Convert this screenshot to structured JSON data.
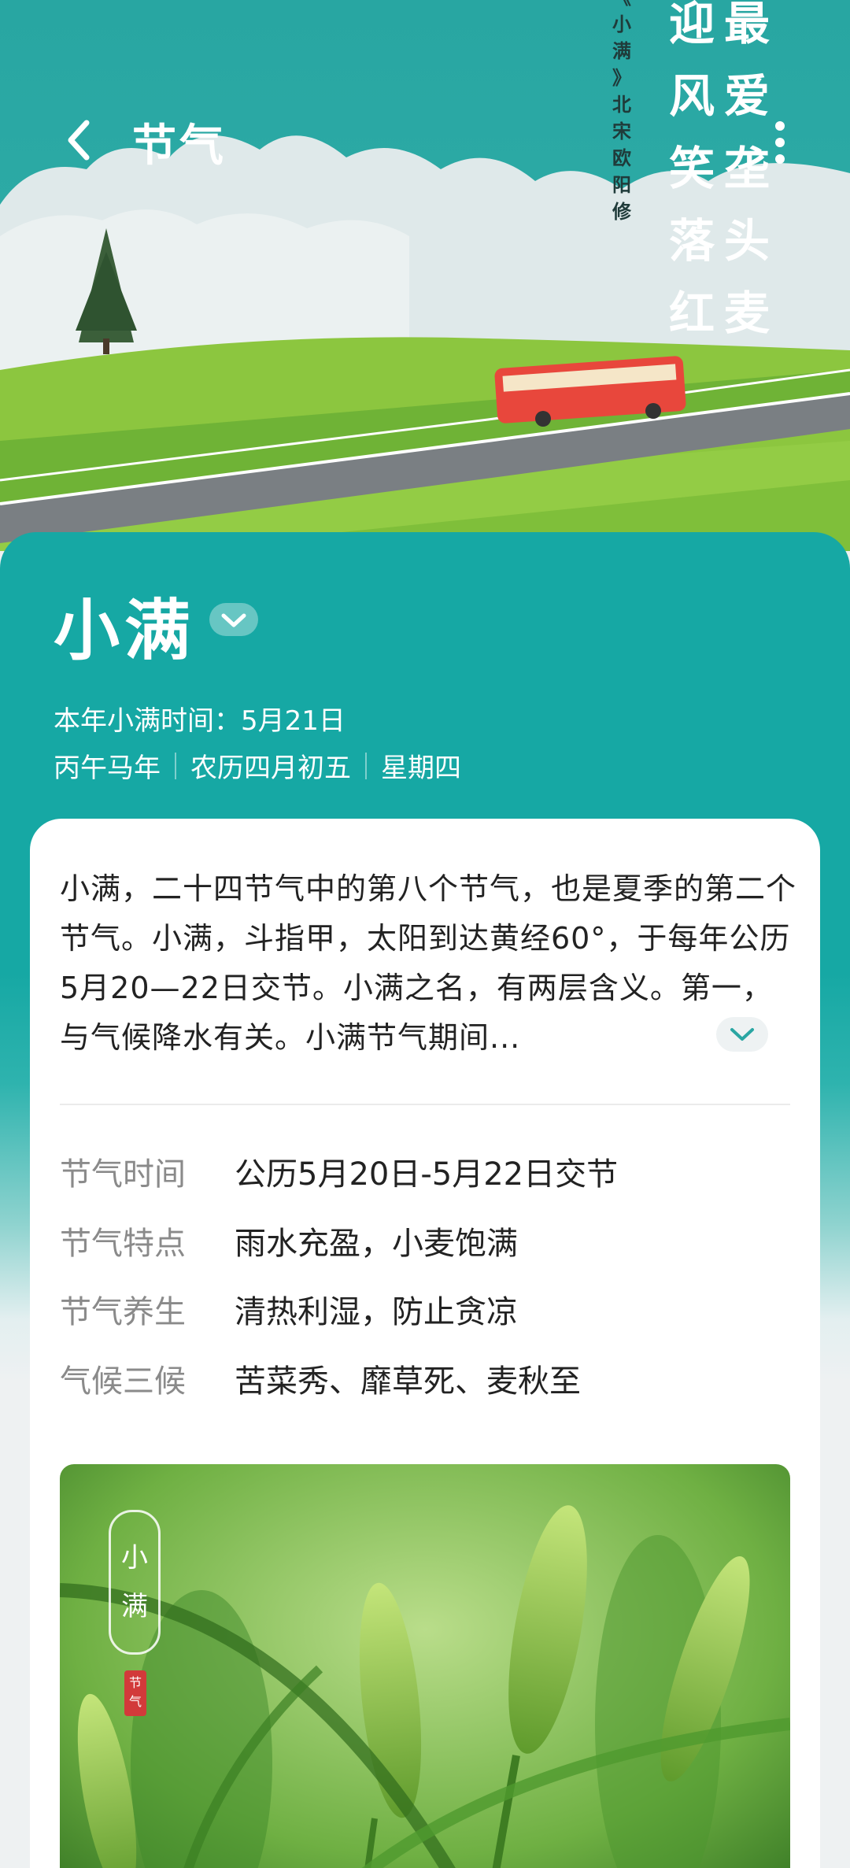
{
  "header": {
    "title": "节气"
  },
  "hero_poem": {
    "big_column_1": [
      "最",
      "爱",
      "垄",
      "头",
      "麦"
    ],
    "big_column_2": [
      "迎",
      "风",
      "笑",
      "落",
      "红"
    ],
    "small_column": [
      "《",
      "小",
      "满",
      "》",
      "北",
      "宋",
      "欧",
      "阳",
      "修"
    ]
  },
  "term": {
    "name": "小满",
    "this_year": "本年小满时间：5月21日",
    "ganzhi": "丙午马年",
    "lunar": "农历四月初五",
    "weekday": "星期四"
  },
  "intro": {
    "text": "小满，二十四节气中的第八个节气，也是夏季的第二个节气。小满，斗指甲，太阳到达黄经60°，于每年公历5月20—22日交节。小满之名，有两层含义。第一，与气候降水有关。小满节气期间..."
  },
  "info": [
    {
      "key": "节气时间",
      "value": "公历5月20日-5月22日交节"
    },
    {
      "key": "节气特点",
      "value": "雨水充盈，小麦饱满"
    },
    {
      "key": "节气养生",
      "value": "清热利湿，防止贪凉"
    },
    {
      "key": "气候三候",
      "value": "苦菜秀、靡草死、麦秋至"
    }
  ],
  "photo": {
    "scroll_title": [
      "小",
      "满"
    ],
    "seal": "节气"
  },
  "colors": {
    "teal": "#16a8a4",
    "sky": "#2aa6a3",
    "field": "#7cc23a",
    "bus": "#e8473c"
  }
}
